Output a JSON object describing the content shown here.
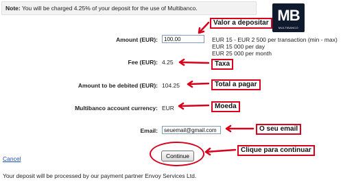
{
  "note": {
    "label": "Note:",
    "text": " You will be charged 4.25% of your deposit for the use of Multibanco."
  },
  "logo": {
    "mark": "MB",
    "sub": "MULTIBANCO"
  },
  "form": {
    "amount": {
      "label": "Amount (EUR):",
      "value": "100.00",
      "limits": [
        "EUR 15 - EUR 2 500 per transaction (min - max)",
        "EUR 15 000 per day",
        "EUR 25 000 per month"
      ]
    },
    "fee": {
      "label": "Fee (EUR):",
      "value": "4.25"
    },
    "debited": {
      "label": "Amount to be debited (EUR):",
      "value": "104.25"
    },
    "currency": {
      "label": "Multibanco account currency:",
      "value": "EUR"
    },
    "email": {
      "label": "Email:",
      "value": "seuemail@gmail.com"
    }
  },
  "actions": {
    "cancel": "Cancel",
    "continue": "Continue"
  },
  "annotations": {
    "amount": "Valor a depositar",
    "fee": "Taxa",
    "total": "Total a pagar",
    "currency": "Moeda",
    "email": "O seu email",
    "continue": "Clique para continuar"
  },
  "footer": "Your deposit will be processed by our payment partner Envoy Services Ltd.",
  "colors": {
    "annotation": "#d8001a",
    "link": "#1a4fbf",
    "logo_bg": "#0f1a2e"
  }
}
